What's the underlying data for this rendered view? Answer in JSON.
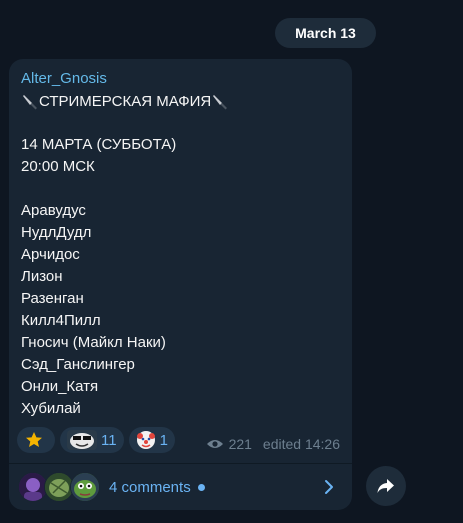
{
  "date_separator": "March 13",
  "message": {
    "author": "Alter_Gnosis",
    "title": "СТРИМЕРСКАЯ МАФИЯ",
    "date_line": "14 МАРТА (СУББОТА)",
    "time_line": "20:00 МСК",
    "players": [
      "Аравудус",
      "НудлДудл",
      "Арчидос",
      "Лизон",
      "Разенган",
      "Килл4Пилл",
      "Гносич (Майкл Наки)",
      "Сэд_Ганслингер",
      "Онли_Катя",
      "Хубилай"
    ],
    "reactions": [
      {
        "icon": "star-emoji",
        "count": ""
      },
      {
        "icon": "meme-face-emoji",
        "count": "11"
      },
      {
        "icon": "clown-emoji",
        "count": "1"
      }
    ],
    "views": "221",
    "edited": "edited 14:26"
  },
  "comments": {
    "label": "4 comments",
    "avatars": [
      "avatar-1",
      "avatar-2",
      "avatar-3"
    ]
  },
  "colors": {
    "background": "#0e1621",
    "bubble": "#182533",
    "accent": "#6ab3f3",
    "author": "#64b9e8"
  }
}
